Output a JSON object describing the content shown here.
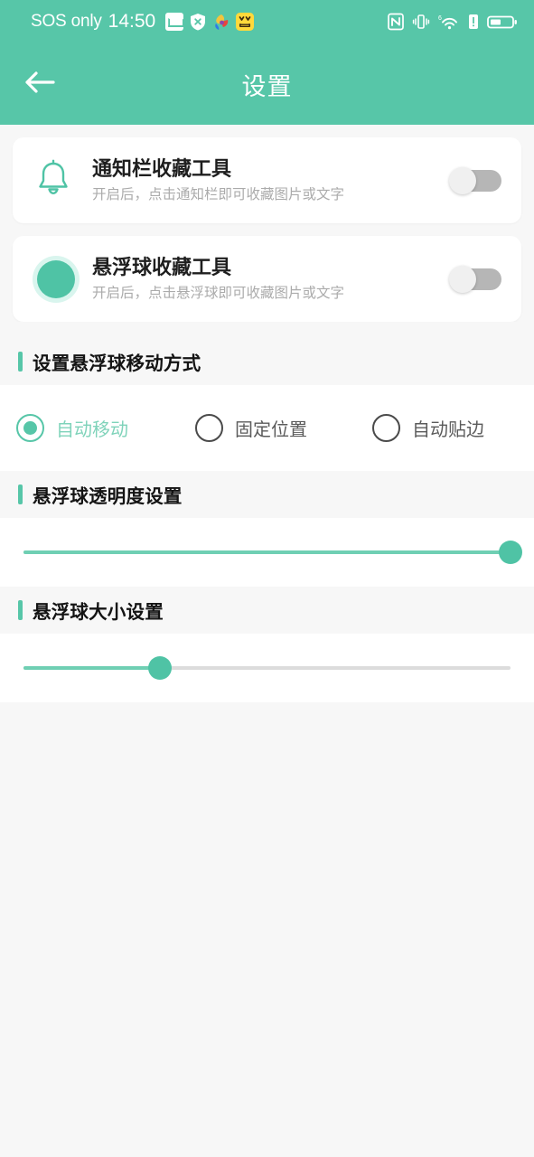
{
  "statusbar": {
    "carrier": "SOS only",
    "clock": "14:50",
    "app_icons": [
      "mail-icon",
      "shield-x-icon",
      "petal-logo-icon",
      "yy-app-icon"
    ],
    "right_icons": [
      "nfc-icon",
      "vibrate-icon",
      "wifi6-icon",
      "alert-icon",
      "battery-icon"
    ],
    "background_color": "#57C6A8"
  },
  "appbar": {
    "title": "设置",
    "back_icon": "back-arrow-icon",
    "background_color": "#57C6A8",
    "text_color": "#FFFFFF"
  },
  "cards": [
    {
      "icon": "bell-icon",
      "title": "通知栏收藏工具",
      "subtitle": "开启后，点击通知栏即可收藏图片或文字",
      "toggle_state": "off"
    },
    {
      "icon": "floating-ball-icon",
      "title": "悬浮球收藏工具",
      "subtitle": "开启后，点击悬浮球即可收藏图片或文字",
      "toggle_state": "off"
    }
  ],
  "sections": [
    {
      "title": "设置悬浮球移动方式",
      "options": [
        {
          "label": "自动移动",
          "selected": true
        },
        {
          "label": "固定位置",
          "selected": false
        },
        {
          "label": "自动贴边",
          "selected": false
        }
      ]
    },
    {
      "title": "悬浮球透明度设置",
      "slider": {
        "value": 100,
        "min": 0,
        "max": 100
      }
    },
    {
      "title": "悬浮球大小设置",
      "slider": {
        "value": 28,
        "min": 0,
        "max": 100
      }
    }
  ],
  "colors": {
    "accent": "#57C6A8",
    "accent_light": "#7FD3BA",
    "slider_fill": "#6FCFB3",
    "page_background": "#F7F7F7",
    "card_background": "#FFFFFF",
    "title_text": "#1E1E1E",
    "subtitle_text": "#ABABAB"
  }
}
